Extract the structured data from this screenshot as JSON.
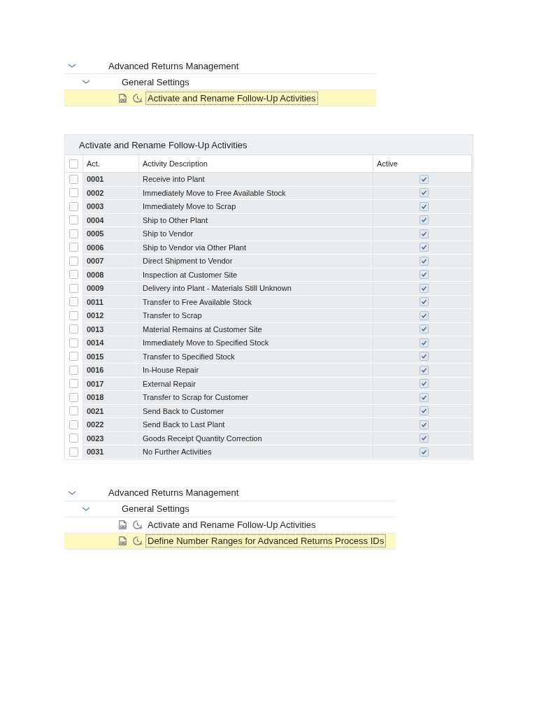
{
  "trees": [
    {
      "items": [
        {
          "label": "Advanced Returns Management",
          "expanded": true,
          "children": [
            {
              "label": "General Settings",
              "expanded": true,
              "children": [
                {
                  "label": "Activate and Rename Follow-Up Activities",
                  "selected": true
                }
              ]
            }
          ]
        }
      ]
    },
    {
      "items": [
        {
          "label": "Advanced Returns Management",
          "expanded": true,
          "children": [
            {
              "label": "General Settings",
              "expanded": true,
              "children": [
                {
                  "label": "Activate and Rename Follow-Up Activities",
                  "selected": false
                },
                {
                  "label": "Define Number Ranges for Advanced Returns Process IDs",
                  "selected": true
                }
              ]
            }
          ]
        }
      ]
    }
  ],
  "table": {
    "title": "Activate and Rename Follow-Up Activities",
    "all_selected": false,
    "columns": [
      "Act.",
      "Activity Description",
      "Active"
    ],
    "rows": [
      {
        "act": "0001",
        "description": "Receive into Plant",
        "active": true,
        "selected": false
      },
      {
        "act": "0002",
        "description": "Immediately Move to Free Available Stock",
        "active": true,
        "selected": false
      },
      {
        "act": "0003",
        "description": "Immediately Move to Scrap",
        "active": true,
        "selected": false
      },
      {
        "act": "0004",
        "description": "Ship to Other Plant",
        "active": true,
        "selected": false
      },
      {
        "act": "0005",
        "description": "Ship to Vendor",
        "active": true,
        "selected": false
      },
      {
        "act": "0006",
        "description": "Ship to Vendor via Other Plant",
        "active": true,
        "selected": false
      },
      {
        "act": "0007",
        "description": "Direct Shipment to Vendor",
        "active": true,
        "selected": false
      },
      {
        "act": "0008",
        "description": "Inspection at Customer Site",
        "active": true,
        "selected": false
      },
      {
        "act": "0009",
        "description": "Delivery into Plant - Materials Still Unknown",
        "active": true,
        "selected": false
      },
      {
        "act": "0011",
        "description": "Transfer to Free Available Stock",
        "active": true,
        "selected": false
      },
      {
        "act": "0012",
        "description": "Transfer to Scrap",
        "active": true,
        "selected": false
      },
      {
        "act": "0013",
        "description": "Material Remains at Customer Site",
        "active": true,
        "selected": false
      },
      {
        "act": "0014",
        "description": "Immediately Move to Specified Stock",
        "active": true,
        "selected": false
      },
      {
        "act": "0015",
        "description": "Transfer to Specified Stock",
        "active": true,
        "selected": false
      },
      {
        "act": "0016",
        "description": "In-House Repair",
        "active": true,
        "selected": false
      },
      {
        "act": "0017",
        "description": "External Repair",
        "active": true,
        "selected": false
      },
      {
        "act": "0018",
        "description": "Transfer to Scrap for Customer",
        "active": true,
        "selected": false
      },
      {
        "act": "0021",
        "description": "Send Back to Customer",
        "active": true,
        "selected": false
      },
      {
        "act": "0022",
        "description": "Send Back to Last Plant",
        "active": true,
        "selected": false
      },
      {
        "act": "0023",
        "description": "Goods Receipt Quantity Correction",
        "active": true,
        "selected": false
      },
      {
        "act": "0031",
        "description": "No Further Activities",
        "active": true,
        "selected": false
      }
    ]
  }
}
